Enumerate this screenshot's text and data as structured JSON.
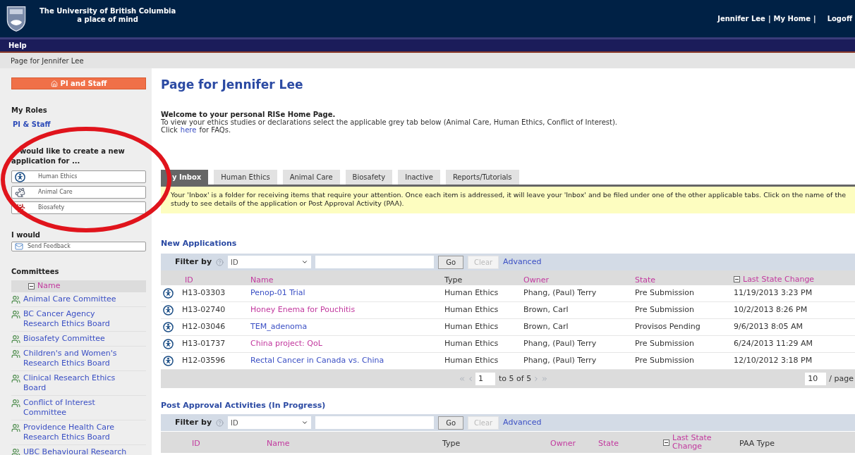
{
  "header": {
    "title": "The University of British Columbia",
    "tagline": "a place of mind",
    "user_links": [
      "Jennifer Lee",
      "My Home",
      "Logoff"
    ],
    "separator": "|"
  },
  "menu": {
    "label": "Help"
  },
  "breadcrumb": "Page for Jennifer Lee",
  "sidebar": {
    "home_button": "PI and Staff",
    "roles_heading": "My Roles",
    "roles": [
      "PI & Staff"
    ],
    "create_heading": "would like to create a new application for ...",
    "create_buttons": [
      {
        "label": "Human Ethics",
        "kind": "human"
      },
      {
        "label": "Animal Care",
        "kind": "animal"
      },
      {
        "label": "Biosafety",
        "kind": "biohazard"
      }
    ],
    "feedback_heading": "I would",
    "feedback_button": "Send Feedback",
    "committees_heading": "Committees",
    "committees_column": "Name",
    "committees": [
      [
        "Animal Care Committee"
      ],
      [
        "BC Cancer Agency",
        "Research Ethics Board"
      ],
      [
        "Biosafety Committee"
      ],
      [
        "Children's and Women's",
        "Research Ethics Board"
      ],
      [
        "Clinical Research Ethics",
        "Board"
      ],
      [
        "Conflict of Interest",
        "Committee"
      ],
      [
        "Providence Health Care",
        "Research Ethics Board"
      ],
      [
        "UBC Behavioural Research"
      ]
    ]
  },
  "main": {
    "title": "Page for Jennifer Lee",
    "welcome": "Welcome to your personal RISe Home Page.",
    "intro": "To view your ethics studies or declarations select the applicable grey tab below (Animal Care, Human Ethics, Conflict of Interest).",
    "faq": {
      "before": "Click",
      "link": "here",
      "after": "for FAQs."
    },
    "tabs": [
      {
        "label": "y Inbox",
        "selected": true
      },
      {
        "label": "Human Ethics",
        "selected": false
      },
      {
        "label": "Animal Care",
        "selected": false
      },
      {
        "label": "Biosafety",
        "selected": false
      },
      {
        "label": "Inactive",
        "selected": false
      },
      {
        "label": "Reports/Tutorials",
        "selected": false
      }
    ],
    "notice": "Your 'Inbox' is a folder for receiving items that require your attention. Once each item is addressed, it will leave your 'Inbox' and be filed under one of the other applicable tabs. Click on the name of the study to see details of the application or Post Approval Activity (PAA).",
    "new_applications": {
      "title": "New Applications",
      "filter": {
        "label": "Filter by",
        "field": "ID",
        "buttons": [
          {
            "label": "Go",
            "disabled": false
          },
          {
            "label": "Clear",
            "disabled": true
          }
        ],
        "advanced": "Advanced"
      },
      "columns": [
        {
          "label": "ID",
          "sortable": true,
          "sorted": false
        },
        {
          "label": "Name",
          "sortable": true,
          "sorted": false
        },
        {
          "label": "Type",
          "sortable": false,
          "sorted": false
        },
        {
          "label": "Owner",
          "sortable": true,
          "sorted": false
        },
        {
          "label": "State",
          "sortable": true,
          "sorted": false
        },
        {
          "label": "Last State Change",
          "sortable": true,
          "sorted": true
        }
      ],
      "rows": [
        {
          "id": "H13-03303",
          "name": "Penop-01 Trial",
          "visited": false,
          "type": "Human Ethics",
          "owner": "Phang, (Paul) Terry",
          "state": "Pre Submission",
          "last_change": "11/19/2013 3:23 PM"
        },
        {
          "id": "H13-02740",
          "name": "Honey Enema for Pouchitis",
          "visited": true,
          "type": "Human Ethics",
          "owner": "Brown, Carl",
          "state": "Pre Submission",
          "last_change": "10/2/2013 8:26 PM"
        },
        {
          "id": "H12-03046",
          "name": "TEM_adenoma",
          "visited": false,
          "type": "Human Ethics",
          "owner": "Brown, Carl",
          "state": "Provisos Pending",
          "last_change": "9/6/2013 8:05 AM"
        },
        {
          "id": "H13-01737",
          "name": "China project: QoL",
          "visited": true,
          "type": "Human Ethics",
          "owner": "Phang, (Paul) Terry",
          "state": "Pre Submission",
          "last_change": "6/24/2013 11:29 AM"
        },
        {
          "id": "H12-03596",
          "name": "Rectal Cancer in Canada vs. China",
          "visited": false,
          "type": "Human Ethics",
          "owner": "Phang, (Paul) Terry",
          "state": "Pre Submission",
          "last_change": "12/10/2012 3:18 PM"
        }
      ],
      "pager": {
        "page": "1",
        "range": "to 5 of 5",
        "per_page": "10",
        "per_page_label": "/ page"
      }
    },
    "post_approval": {
      "title": "Post Approval Activities (In Progress)",
      "filter": {
        "label": "Filter by",
        "field": "ID",
        "buttons": [
          {
            "label": "Go",
            "disabled": false
          },
          {
            "label": "Clear",
            "disabled": true
          }
        ],
        "advanced": "Advanced"
      },
      "columns": [
        {
          "label": "ID",
          "sortable": true,
          "sorted": false
        },
        {
          "label": "Name",
          "sortable": true,
          "sorted": false
        },
        {
          "label": "Type",
          "sortable": false,
          "sorted": false
        },
        {
          "label": "Owner",
          "sortable": true,
          "sorted": false
        },
        {
          "label": "State",
          "sortable": true,
          "sorted": false
        },
        {
          "label": "Last State Change",
          "sortable": true,
          "sorted": true
        },
        {
          "label": "PAA Type",
          "sortable": false,
          "sorted": false
        }
      ]
    }
  }
}
